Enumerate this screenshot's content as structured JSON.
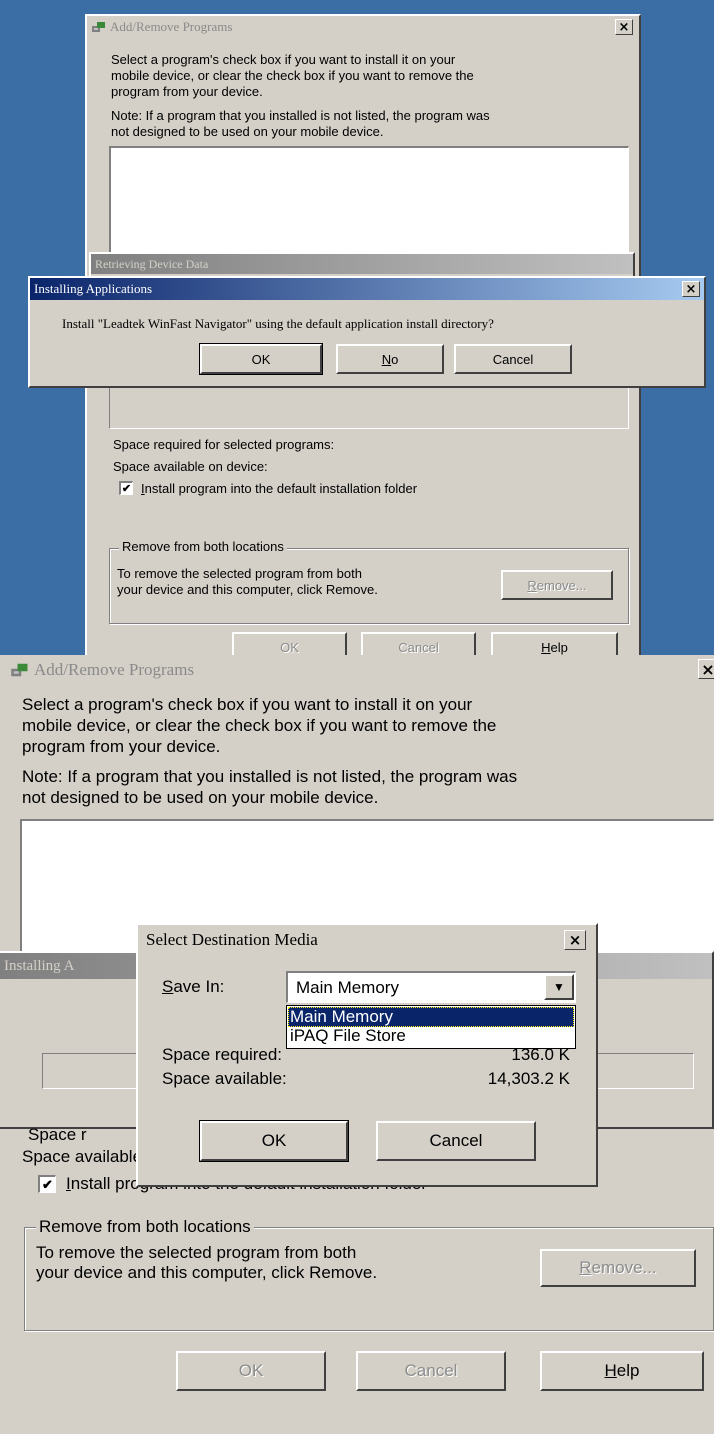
{
  "top": {
    "main": {
      "title": "Add/Remove Programs",
      "close": "×",
      "instruction": [
        "Select a program's check box if you want to install it on your",
        "mobile device, or clear the check box if you want to remove the",
        "program from your device."
      ],
      "note": [
        "Note:  If a program that you installed is not listed, the program was",
        "not designed to be used on your mobile device."
      ],
      "space_required_label": "Space required for selected programs:",
      "space_available_label": "Space available on device:",
      "install_checkbox": "✔",
      "install_label_u": "I",
      "install_label_rest": "nstall program into the default installation folder",
      "group_title": "Remove from both locations",
      "group_text": [
        "To remove the selected program from both",
        "your device and this computer, click Remove."
      ],
      "remove_u": "R",
      "remove_rest": "emove...",
      "ok": "OK",
      "cancel": "Cancel",
      "help_u": "H",
      "help_rest": "elp"
    },
    "retrieving_title": "Retrieving Device Data",
    "install_dialog": {
      "title": "Installing Applications",
      "close": "×",
      "question": "Install \"Leadtek WinFast Navigator\" using the default application install directory?",
      "ok": "OK",
      "no_u": "N",
      "no_rest": "o",
      "cancel": "Cancel"
    }
  },
  "bottom": {
    "main": {
      "title": "Add/Remove Programs",
      "close": "×",
      "instruction": [
        "Select a program's check box if you want to install it on your",
        "mobile device, or clear the check box if you want to remove the",
        "program from your device."
      ],
      "note": [
        "Note:  If a program that you installed is not listed, the program was",
        "not designed to be used on your mobile device."
      ],
      "space_required_label": "Space r",
      "space_available_label": "Space available on device:",
      "install_checkbox": "✔",
      "install_label_u": "I",
      "install_label_rest": "nstall program into the default installation folder",
      "group_title": "Remove from both locations",
      "group_text": [
        "To remove the selected program from both",
        "your device and this computer, click Remove."
      ],
      "remove_u": "R",
      "remove_rest": "emove...",
      "ok": "OK",
      "cancel": "Cancel",
      "help_u": "H",
      "help_rest": "elp"
    },
    "installing_title": "Installing A",
    "dest_dialog": {
      "title": "Select Destination Media",
      "close": "×",
      "save_in_u": "S",
      "save_in_rest": "ave In:",
      "selected": "Main Memory",
      "dropdown_arrow": "▼",
      "options": [
        "Main Memory",
        "iPAQ File Store"
      ],
      "space_required_label": "Space required:",
      "space_required_value": "136.0 K",
      "space_available_label": "Space available:",
      "space_available_value": "14,303.2 K",
      "ok": "OK",
      "cancel": "Cancel"
    }
  }
}
